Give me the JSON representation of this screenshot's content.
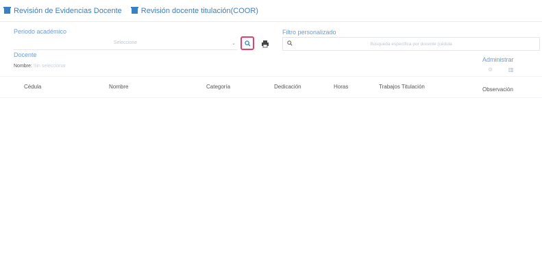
{
  "tabs": [
    {
      "label": "Revisión de Evidencias Docente",
      "icon": "box-icon"
    },
    {
      "label": "Revisión docente titulación(COOR)",
      "icon": "box-icon"
    }
  ],
  "periodo": {
    "label": "Periodo académico",
    "placeholder": "Seleccione"
  },
  "filtro": {
    "label": "Filtro personalizado",
    "placeholder": "Búsqueda específica por docente (cédula"
  },
  "docente": {
    "label": "Docente",
    "nombre_label": "Nombre:",
    "nombre_value": "Sin seleccionar"
  },
  "admin": {
    "label": "Administrar"
  },
  "table": {
    "columns": [
      "Cédula",
      "Nombre",
      "Categoría",
      "Dedicación",
      "Horas",
      "Trabajos Titulación",
      "Observación"
    ],
    "rows": []
  },
  "colors": {
    "accent": "#3a7fc2",
    "highlight": "#e23f6b",
    "label": "#6e9bd0"
  }
}
